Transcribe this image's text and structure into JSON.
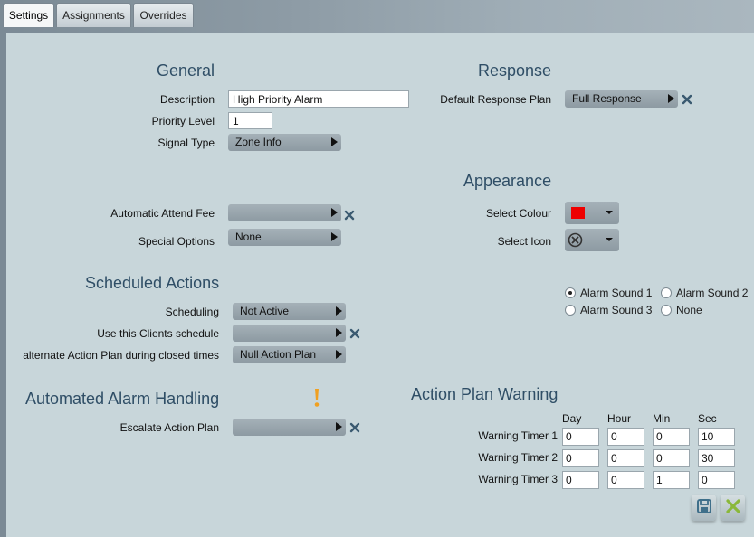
{
  "tabs": [
    {
      "label": "Settings"
    },
    {
      "label": "Assignments"
    },
    {
      "label": "Overrides"
    }
  ],
  "general": {
    "heading": "General",
    "description_label": "Description",
    "description_value": "High Priority Alarm",
    "priority_label": "Priority Level",
    "priority_value": "1",
    "signal_type_label": "Signal Type",
    "signal_type_value": "Zone Info",
    "attend_fee_label": "Automatic Attend Fee",
    "attend_fee_value": "",
    "special_options_label": "Special Options",
    "special_options_value": "None"
  },
  "response": {
    "heading": "Response",
    "plan_label": "Default Response Plan",
    "plan_value": "Full Response"
  },
  "appearance": {
    "heading": "Appearance",
    "colour_label": "Select Colour",
    "colour_value": "#ee0000",
    "icon_label": "Select Icon",
    "icon_name": "circle-x-icon"
  },
  "sounds": {
    "options": [
      {
        "label": "Alarm Sound 1",
        "checked": true
      },
      {
        "label": "Alarm Sound 2",
        "checked": false
      },
      {
        "label": "Alarm Sound 3",
        "checked": false
      },
      {
        "label": "None",
        "checked": false
      }
    ]
  },
  "scheduled": {
    "heading": "Scheduled Actions",
    "scheduling_label": "Scheduling",
    "scheduling_value": "Not Active",
    "clients_schedule_label": "Use this Clients schedule",
    "clients_schedule_value": "",
    "alternate_label": "alternate Action Plan during closed times",
    "alternate_value": "Null Action Plan"
  },
  "automated": {
    "heading": "Automated Alarm Handling",
    "warning_icon": "exclamation-icon",
    "warning_color": "#f0a020",
    "escalate_label": "Escalate Action Plan",
    "escalate_value": ""
  },
  "action_plan_warning": {
    "heading": "Action Plan Warning",
    "columns": [
      "Day",
      "Hour",
      "Min",
      "Sec"
    ],
    "timers": [
      {
        "label": "Warning Timer 1",
        "values": [
          "0",
          "0",
          "0",
          "10"
        ]
      },
      {
        "label": "Warning Timer 2",
        "values": [
          "0",
          "0",
          "0",
          "30"
        ]
      },
      {
        "label": "Warning Timer 3",
        "values": [
          "0",
          "0",
          "1",
          "0"
        ]
      }
    ]
  },
  "buttons": {
    "save_icon": "save-icon",
    "cancel_icon": "close-icon",
    "accent": "#4a7fa0",
    "save_color": "#3f6f8a",
    "cancel_color": "#8ab83a"
  }
}
